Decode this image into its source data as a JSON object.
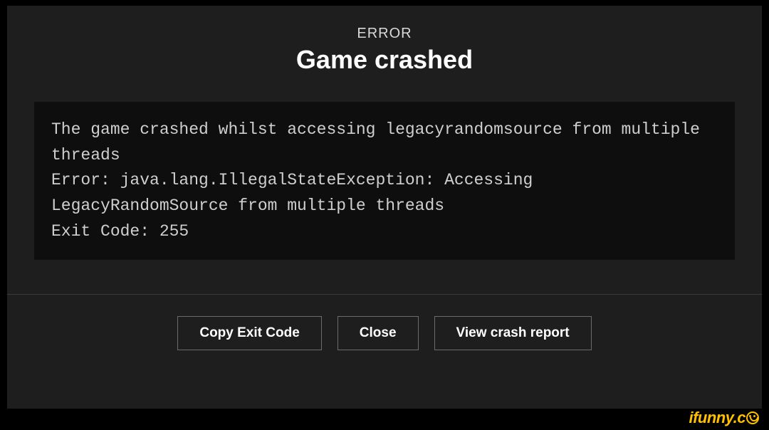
{
  "header": {
    "label": "ERROR",
    "title": "Game crashed"
  },
  "error_text": "The game crashed whilst accessing legacyrandomsource from multiple threads\nError: java.lang.IllegalStateException: Accessing LegacyRandomSource from multiple threads\nExit Code: 255",
  "buttons": {
    "copy": "Copy Exit Code",
    "close": "Close",
    "view": "View crash report"
  },
  "watermark": "ifunny.c"
}
